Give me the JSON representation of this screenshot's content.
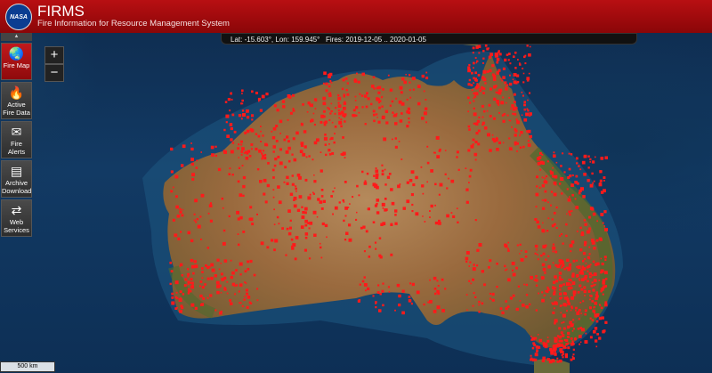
{
  "header": {
    "logo_text": "NASA",
    "title": "FIRMS",
    "subtitle": "Fire Information for Resource Management System"
  },
  "status": {
    "lat_label": "Lat:",
    "lat": "-15.603°",
    "lon_label": "Lon:",
    "lon": "159.945°",
    "fires_label": "Fires:",
    "fires_range": "2019-12-05 .. 2020-01-05"
  },
  "sidebar": {
    "scroll_up": "▲",
    "items": [
      {
        "label": "Fire Map",
        "icon": "globe-icon"
      },
      {
        "label": "Active Fire Data",
        "icon": "flame-icon"
      },
      {
        "label": "Fire Alerts",
        "icon": "envelope-icon"
      },
      {
        "label": "Archive Download",
        "icon": "archive-box-icon"
      },
      {
        "label": "Web Services",
        "icon": "arrows-icon"
      }
    ]
  },
  "zoom": {
    "in": "+",
    "out": "−"
  },
  "scale": {
    "label": "500 km"
  },
  "colors": {
    "header": "#b80f12",
    "fire": "#ff1a1a",
    "ocean": "#123a64",
    "land": "#9a6a3e"
  }
}
